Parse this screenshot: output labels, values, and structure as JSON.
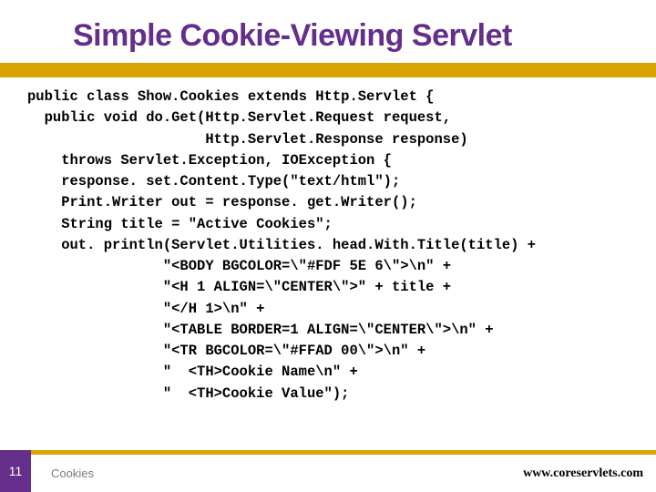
{
  "title": "Simple Cookie-Viewing Servlet",
  "code": "public class Show.Cookies extends Http.Servlet {\n  public void do.Get(Http.Servlet.Request request,\n                     Http.Servlet.Response response)\n    throws Servlet.Exception, IOException {\n    response. set.Content.Type(\"text/html\");\n    Print.Writer out = response. get.Writer();\n    String title = \"Active Cookies\";\n    out. println(Servlet.Utilities. head.With.Title(title) +\n                \"<BODY BGCOLOR=\\\"#FDF 5E 6\\\">\\n\" +\n                \"<H 1 ALIGN=\\\"CENTER\\\">\" + title +\n                \"</H 1>\\n\" +\n                \"<TABLE BORDER=1 ALIGN=\\\"CENTER\\\">\\n\" +\n                \"<TR BGCOLOR=\\\"#FFAD 00\\\">\\n\" +\n                \"  <TH>Cookie Name\\n\" +\n                \"  <TH>Cookie Value\");",
  "slide_number": "11",
  "footer_left": "Cookies",
  "footer_right": "www.coreservlets.com"
}
